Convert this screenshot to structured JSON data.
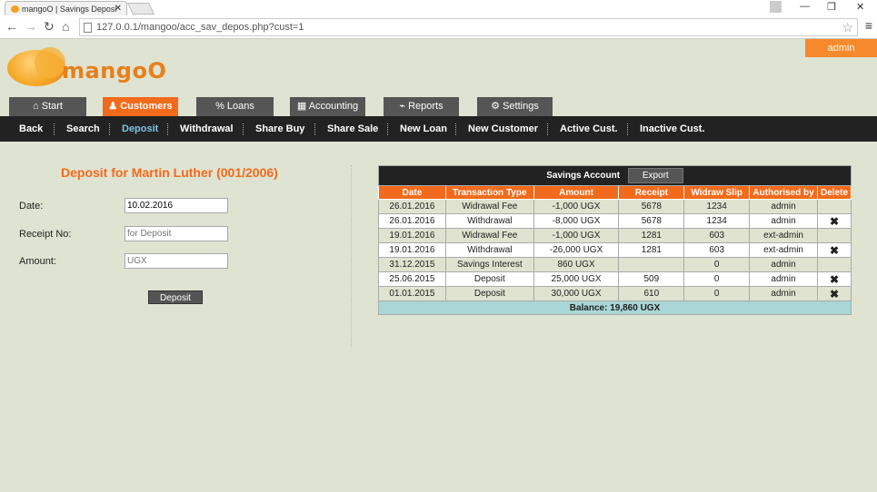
{
  "browser": {
    "tab_title": "mangoO | Savings Deposi",
    "url": "127.0.0.1/mangoo/acc_sav_depos.php?cust=1"
  },
  "header": {
    "logo_text": "mangoO",
    "user": "admin"
  },
  "main_tabs": [
    {
      "label": "Start",
      "icon": "home-icon"
    },
    {
      "label": "Customers",
      "icon": "user-icon"
    },
    {
      "label": "Loans",
      "icon": "percent-icon"
    },
    {
      "label": "Accounting",
      "icon": "calculator-icon"
    },
    {
      "label": "Reports",
      "icon": "chart-icon"
    },
    {
      "label": "Settings",
      "icon": "gear-icon"
    }
  ],
  "subnav": [
    "Back",
    "Search",
    "Deposit",
    "Withdrawal",
    "Share Buy",
    "Share Sale",
    "New Loan",
    "New Customer",
    "Active Cust.",
    "Inactive Cust."
  ],
  "form": {
    "title": "Deposit for Martin Luther (001/2006)",
    "date_label": "Date:",
    "date_value": "10.02.2016",
    "receipt_label": "Receipt No:",
    "receipt_placeholder": "for Deposit",
    "amount_label": "Amount:",
    "amount_placeholder": "UGX",
    "submit_label": "Deposit"
  },
  "account": {
    "title": "Savings Account",
    "export_label": "Export",
    "columns": [
      "Date",
      "Transaction Type",
      "Amount",
      "Receipt",
      "Widraw Slip",
      "Authorised by",
      "Delete"
    ],
    "rows": [
      {
        "date": "26.01.2016",
        "type": "Widrawal Fee",
        "amount": "-1,000 UGX",
        "receipt": "5678",
        "slip": "1234",
        "by": "admin",
        "delete": ""
      },
      {
        "date": "26.01.2016",
        "type": "Withdrawal",
        "amount": "-8,000 UGX",
        "receipt": "5678",
        "slip": "1234",
        "by": "admin",
        "delete": "✖"
      },
      {
        "date": "19.01.2016",
        "type": "Widrawal Fee",
        "amount": "-1,000 UGX",
        "receipt": "1281",
        "slip": "603",
        "by": "ext-admin",
        "delete": ""
      },
      {
        "date": "19.01.2016",
        "type": "Withdrawal",
        "amount": "-26,000 UGX",
        "receipt": "1281",
        "slip": "603",
        "by": "ext-admin",
        "delete": "✖"
      },
      {
        "date": "31.12.2015",
        "type": "Savings Interest",
        "amount": "860 UGX",
        "receipt": "",
        "slip": "0",
        "by": "admin",
        "delete": ""
      },
      {
        "date": "25.06.2015",
        "type": "Deposit",
        "amount": "25,000 UGX",
        "receipt": "509",
        "slip": "0",
        "by": "admin",
        "delete": "✖"
      },
      {
        "date": "01.01.2015",
        "type": "Deposit",
        "amount": "30,000 UGX",
        "receipt": "610",
        "slip": "0",
        "by": "admin",
        "delete": "✖"
      }
    ],
    "balance": "Balance: 19,860 UGX"
  },
  "colors": {
    "accent": "#f26a1b",
    "nav_bg": "#222222",
    "page_bg": "#dfe3d2",
    "balance_bg": "#a9d6d6"
  }
}
